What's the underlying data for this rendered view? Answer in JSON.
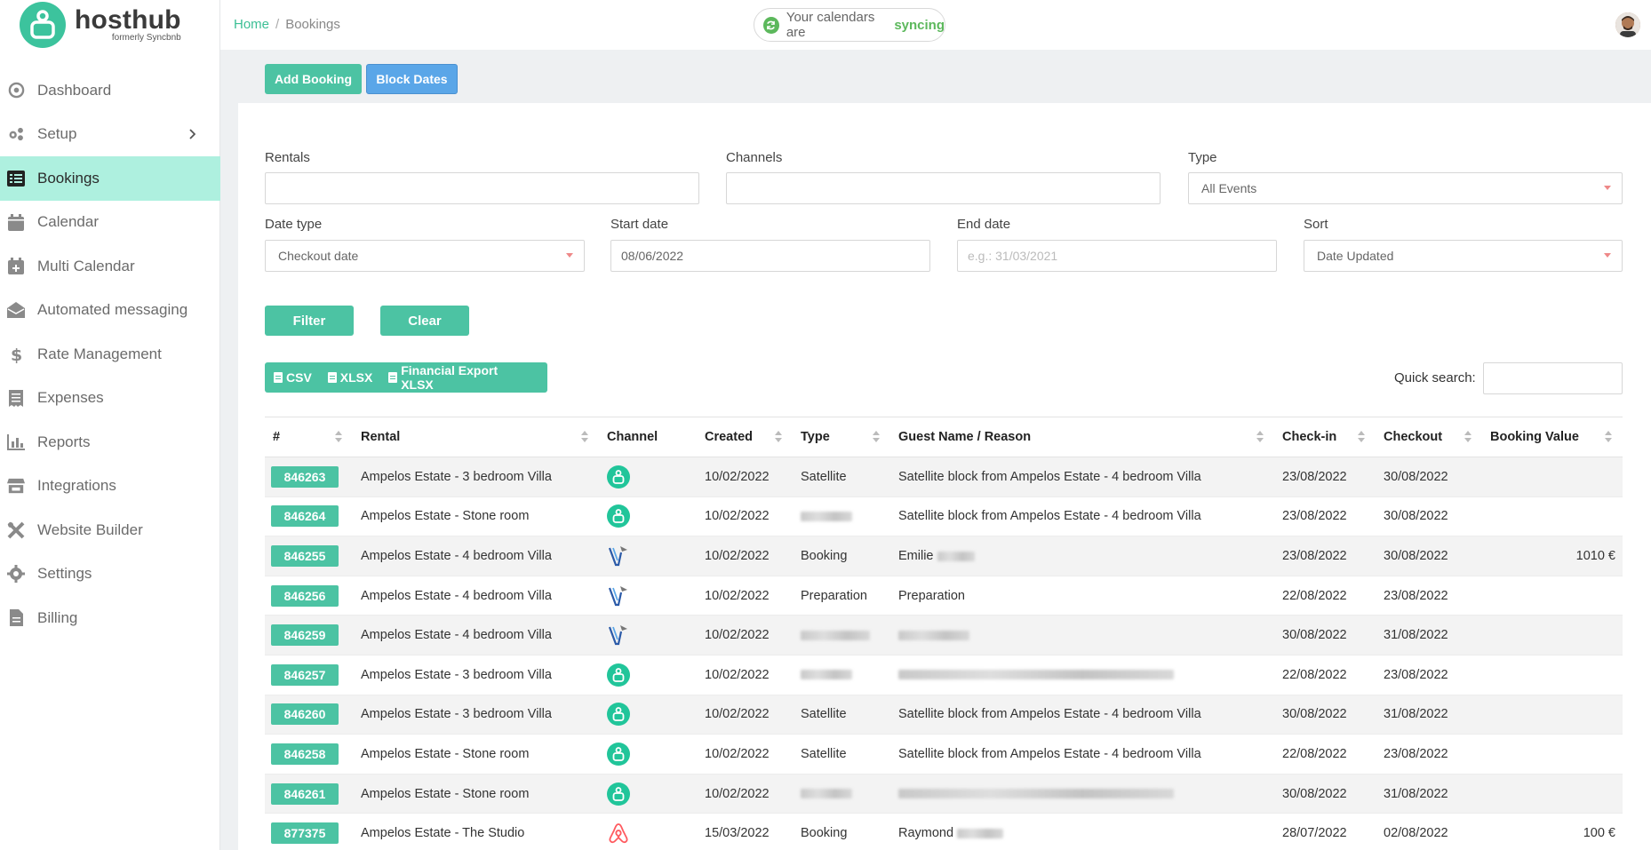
{
  "app": {
    "brand": "hosthub",
    "brand_sub": "formerly Syncbnb"
  },
  "sidebar": {
    "items": [
      {
        "label": "Dashboard",
        "icon": "dashboard-icon"
      },
      {
        "label": "Setup",
        "icon": "gears-icon"
      },
      {
        "label": "Bookings",
        "icon": "list-icon",
        "active": true
      },
      {
        "label": "Calendar",
        "icon": "calendar-icon"
      },
      {
        "label": "Multi Calendar",
        "icon": "calendar-plus-icon"
      },
      {
        "label": "Automated messaging",
        "icon": "envelope-open-icon"
      },
      {
        "label": "Rate Management",
        "icon": "dollar-icon"
      },
      {
        "label": "Expenses",
        "icon": "receipt-icon"
      },
      {
        "label": "Reports",
        "icon": "bar-chart-icon"
      },
      {
        "label": "Integrations",
        "icon": "store-icon"
      },
      {
        "label": "Website Builder",
        "icon": "tools-icon"
      },
      {
        "label": "Settings",
        "icon": "gear-icon"
      },
      {
        "label": "Billing",
        "icon": "file-icon"
      }
    ]
  },
  "topbar": {
    "breadcrumb_home": "Home",
    "breadcrumb_sep": "/",
    "breadcrumb_current": "Bookings",
    "sync_text": "Your calendars are",
    "sync_status": "syncing"
  },
  "actions": {
    "add_booking": "Add Booking",
    "block_dates": "Block Dates"
  },
  "filters": {
    "rentals_label": "Rentals",
    "rentals_value": "",
    "channels_label": "Channels",
    "channels_value": "",
    "type_label": "Type",
    "type_value": "All Events",
    "date_type_label": "Date type",
    "date_type_value": "Checkout date",
    "start_date_label": "Start date",
    "start_date_value": "08/06/2022",
    "end_date_label": "End date",
    "end_date_placeholder": "e.g.: 31/03/2021",
    "sort_label": "Sort",
    "sort_value": "Date Updated",
    "filter_button": "Filter",
    "clear_button": "Clear"
  },
  "export": {
    "csv": "CSV",
    "xlsx": "XLSX",
    "financial": "Financial Export XLSX"
  },
  "quick_search": {
    "label": "Quick search:",
    "value": ""
  },
  "table": {
    "columns": [
      "#",
      "Rental",
      "Channel",
      "Created",
      "Type",
      "Guest Name / Reason",
      "Check-in",
      "Checkout",
      "Booking Value"
    ],
    "rows": [
      {
        "id": "846263",
        "rental": "Ampelos Estate - 3 bedroom Villa",
        "channel": "hosthub",
        "created": "10/02/2022",
        "type": "Satellite",
        "guest": "Satellite block from Ampelos Estate - 4 bedroom Villa",
        "checkin": "23/08/2022",
        "checkout": "30/08/2022",
        "value": ""
      },
      {
        "id": "846264",
        "rental": "Ampelos Estate - Stone room",
        "channel": "hosthub",
        "created": "10/02/2022",
        "type": "",
        "guest": "Satellite block from Ampelos Estate - 4 bedroom Villa",
        "checkin": "23/08/2022",
        "checkout": "30/08/2022",
        "value": ""
      },
      {
        "id": "846255",
        "rental": "Ampelos Estate - 4 bedroom Villa",
        "channel": "vrbo",
        "created": "10/02/2022",
        "type": "Booking",
        "guest": "Emilie",
        "checkin": "23/08/2022",
        "checkout": "30/08/2022",
        "value": "1010 €"
      },
      {
        "id": "846256",
        "rental": "Ampelos Estate - 4 bedroom Villa",
        "channel": "vrbo",
        "created": "10/02/2022",
        "type": "Preparation",
        "guest": "Preparation",
        "checkin": "22/08/2022",
        "checkout": "23/08/2022",
        "value": ""
      },
      {
        "id": "846259",
        "rental": "Ampelos Estate - 4 bedroom Villa",
        "channel": "vrbo",
        "created": "10/02/2022",
        "type": "",
        "guest": "",
        "checkin": "30/08/2022",
        "checkout": "31/08/2022",
        "value": ""
      },
      {
        "id": "846257",
        "rental": "Ampelos Estate - 3 bedroom Villa",
        "channel": "hosthub",
        "created": "10/02/2022",
        "type": "",
        "guest": "",
        "checkin": "22/08/2022",
        "checkout": "23/08/2022",
        "value": ""
      },
      {
        "id": "846260",
        "rental": "Ampelos Estate - 3 bedroom Villa",
        "channel": "hosthub",
        "created": "10/02/2022",
        "type": "Satellite",
        "guest": "Satellite block from Ampelos Estate - 4 bedroom Villa",
        "checkin": "30/08/2022",
        "checkout": "31/08/2022",
        "value": ""
      },
      {
        "id": "846258",
        "rental": "Ampelos Estate - Stone room",
        "channel": "hosthub",
        "created": "10/02/2022",
        "type": "Satellite",
        "guest": "Satellite block from Ampelos Estate - 4 bedroom Villa",
        "checkin": "22/08/2022",
        "checkout": "23/08/2022",
        "value": ""
      },
      {
        "id": "846261",
        "rental": "Ampelos Estate - Stone room",
        "channel": "hosthub",
        "created": "10/02/2022",
        "type": "",
        "guest": "",
        "checkin": "30/08/2022",
        "checkout": "31/08/2022",
        "value": ""
      },
      {
        "id": "877375",
        "rental": "Ampelos Estate - The Studio",
        "channel": "airbnb",
        "created": "15/03/2022",
        "type": "Booking",
        "guest": "Raymond",
        "checkin": "28/07/2022",
        "checkout": "02/08/2022",
        "value": "100 €"
      }
    ]
  },
  "colors": {
    "brand": "#3cc39d",
    "accent_blue": "#5aa6e8",
    "active_nav": "#aef0df",
    "airbnb": "#ff5a5f"
  }
}
